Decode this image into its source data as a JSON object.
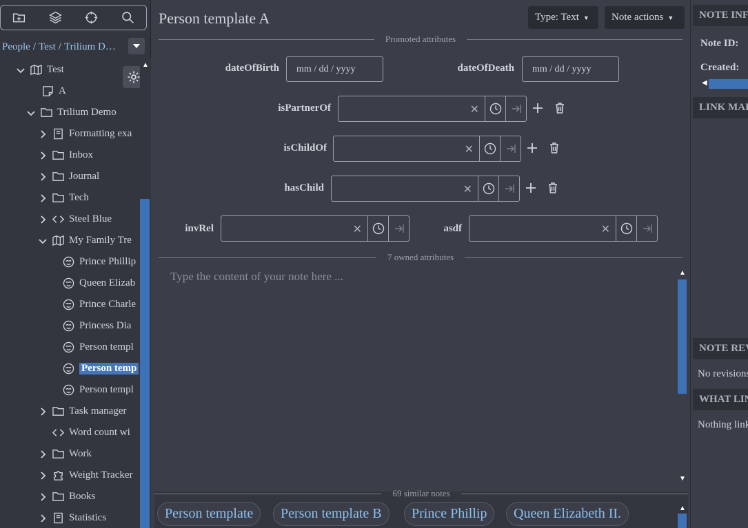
{
  "tree": {
    "breadcrumb": [
      "People",
      "Test",
      "Trilium D…"
    ],
    "items": [
      {
        "label": "Test",
        "expanded": true
      },
      {
        "label": "A"
      },
      {
        "label": "Trilium Demo",
        "expanded": true
      },
      {
        "label": "Formatting exa"
      },
      {
        "label": "Inbox"
      },
      {
        "label": "Journal"
      },
      {
        "label": "Tech"
      },
      {
        "label": "Steel Blue"
      },
      {
        "label": "My Family Tre",
        "expanded": true
      },
      {
        "label": "Prince Phillip"
      },
      {
        "label": "Queen Elizab"
      },
      {
        "label": "Prince Charle"
      },
      {
        "label": "Princess Dia"
      },
      {
        "label": "Person templ"
      },
      {
        "label": "Person temp",
        "active": true
      },
      {
        "label": "Person templ"
      },
      {
        "label": "Task manager"
      },
      {
        "label": "Word count wi"
      },
      {
        "label": "Work"
      },
      {
        "label": "Weight Tracker"
      },
      {
        "label": "Books"
      },
      {
        "label": "Statistics"
      }
    ]
  },
  "note": {
    "title": "Person template A",
    "type_label": "Type: Text",
    "actions_label": "Note actions",
    "promoted_label": "Promoted attributes",
    "owned_label": "7 owned attributes",
    "placeholder": "Type the content of your note here ...",
    "date_placeholder": "mm / dd / yyyy",
    "attrs": {
      "dateOfBirth": "dateOfBirth",
      "dateOfDeath": "dateOfDeath",
      "isPartnerOf": "isPartnerOf",
      "isChildOf": "isChildOf",
      "hasChild": "hasChild",
      "invRel": "invRel",
      "asdf": "asdf"
    },
    "clear_glyph": "✕"
  },
  "similar": {
    "label": "69 similar notes",
    "items": [
      "Person template",
      "Person template B",
      "Prince Phillip",
      "Queen Elizabeth II."
    ]
  },
  "right": {
    "note_info": "NOTE INFO",
    "note_id": "Note ID:",
    "created": "Created:",
    "link_map": "LINK MAP",
    "note_revisions": "NOTE REVISIONS",
    "no_revisions": "No revisions",
    "what_links": "WHAT LINKS",
    "nothing_links": "Nothing links"
  },
  "colors": {
    "accent": "#3e72b6",
    "link": "#9bc4ee"
  }
}
